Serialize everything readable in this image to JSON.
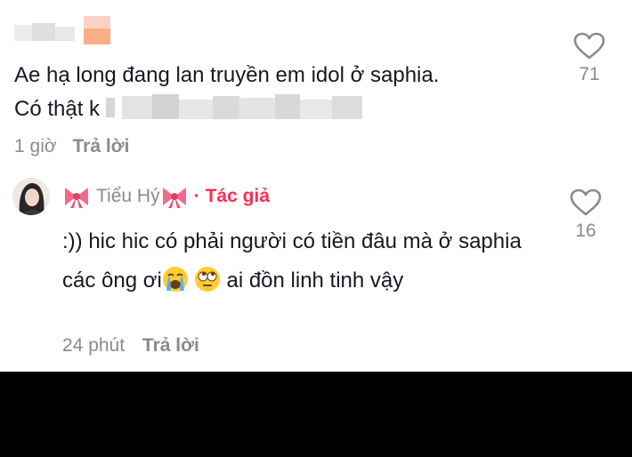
{
  "comments": [
    {
      "text_visible_prefix_line1": "Ae hạ long đang lan truyền em idol ở saphia.",
      "text_visible_prefix_line2": "Có thật k ",
      "time": "1 giờ",
      "reply_label": "Trả lời",
      "likes": "71"
    },
    {
      "author": "Tiểu Hý",
      "author_badge": "Tác giả",
      "text_part1": ":)) hic hic có phải người có tiền đâu mà ở saphia các ông ơi",
      "text_part2": " ai đồn linh tinh vậy",
      "emojis": [
        "crying-face",
        "rolling-eyes-face"
      ],
      "time": "24 phút",
      "reply_label": "Trả lời",
      "likes": "16"
    }
  ],
  "colors": {
    "text": "#161823",
    "muted": "#8a8b91",
    "author_badge": "#fe2c55",
    "bow": "#f06a8c",
    "bottom_bar": "#000000"
  }
}
